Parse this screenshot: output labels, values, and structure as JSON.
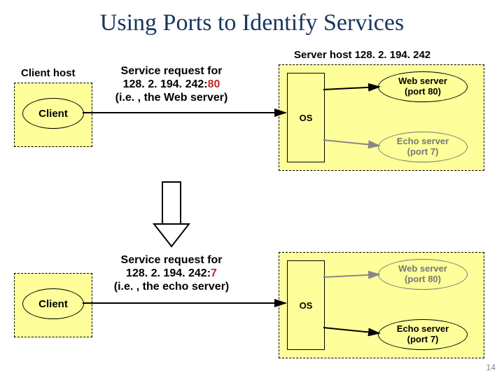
{
  "title": "Using Ports to Identify Services",
  "server_host_label": "Server host 128. 2. 194. 242",
  "client_host_label": "Client host",
  "client_label": "Client",
  "os_label": "OS",
  "page_number": "14",
  "req1": {
    "l1": "Service request for",
    "l2a": "128. 2. 194. 242:",
    "l2b": "80",
    "l3": "(i.e. , the Web server)"
  },
  "req2": {
    "l1": "Service request for",
    "l2a": "128. 2. 194. 242:",
    "l2b": "7",
    "l3": "(i.e. , the echo server)"
  },
  "web_server": {
    "l1": "Web server",
    "l2": "(port 80)"
  },
  "echo_server": {
    "l1": "Echo server",
    "l2": "(port 7)"
  }
}
